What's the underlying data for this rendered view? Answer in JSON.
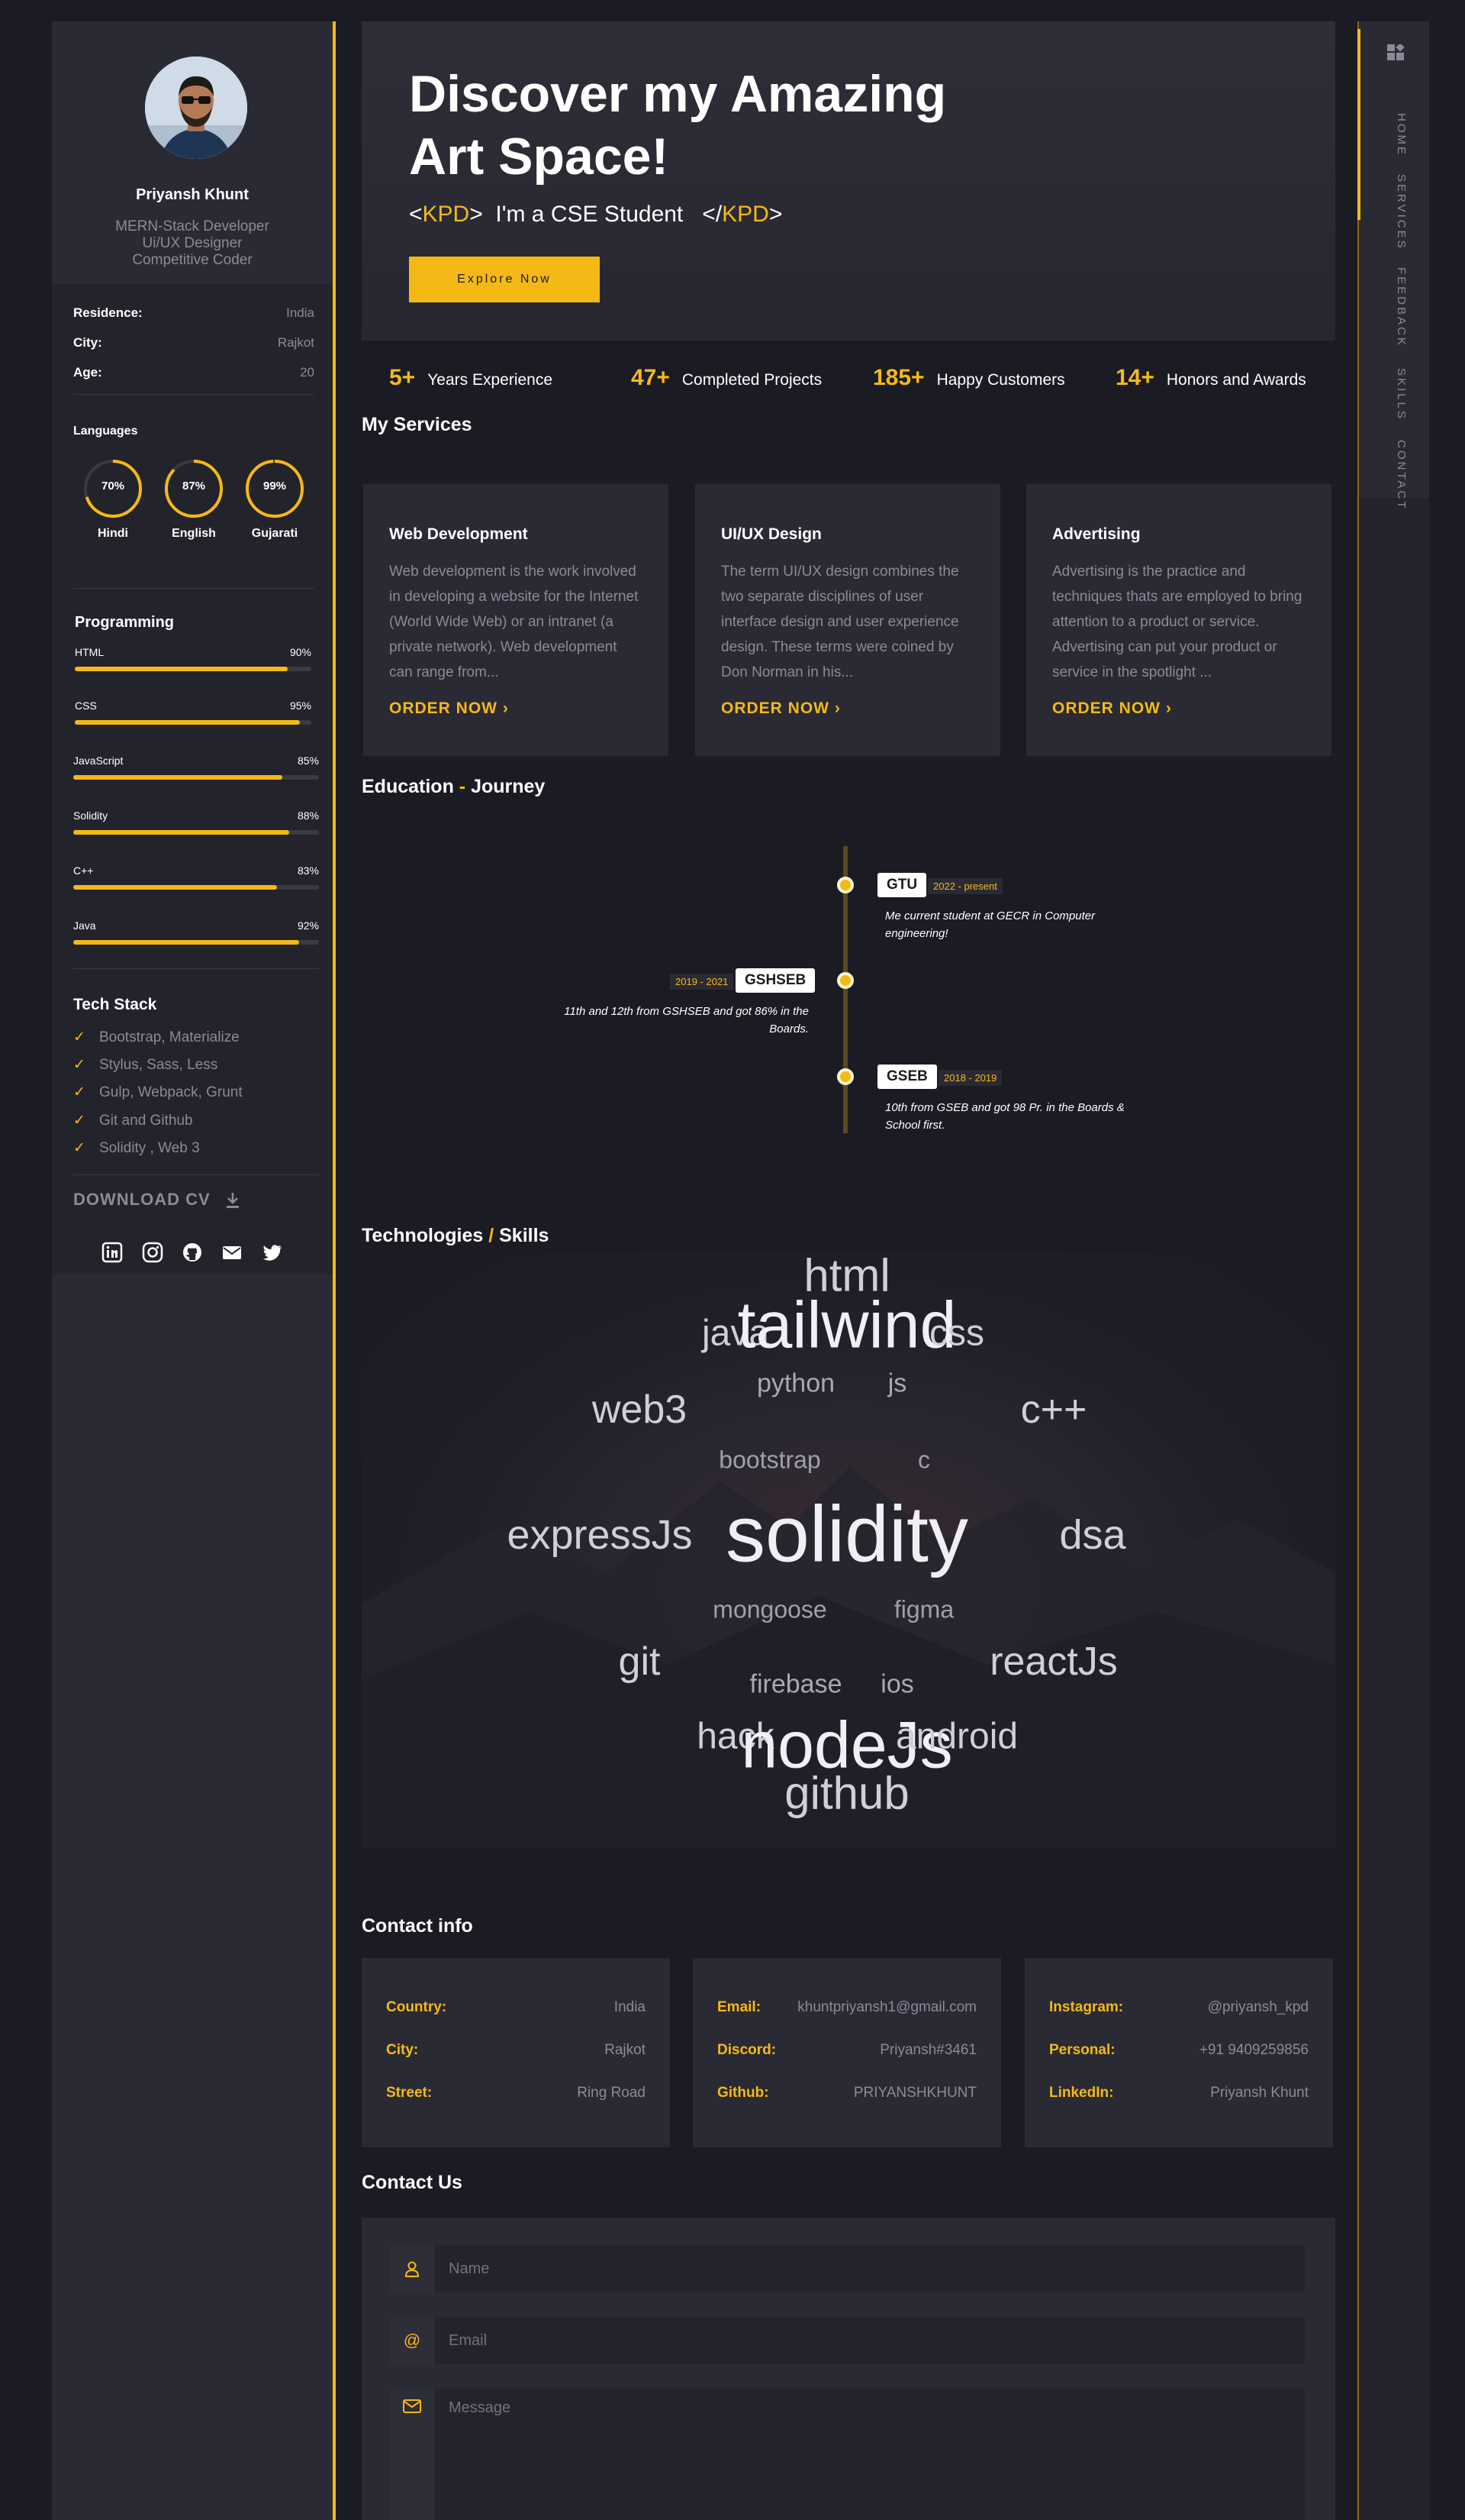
{
  "profile": {
    "name": "Priyansh Khunt",
    "roles": [
      "MERN-Stack Developer",
      "Ui/UX Designer",
      "Competitive Coder"
    ]
  },
  "info": [
    {
      "label": "Residence:",
      "value": "India"
    },
    {
      "label": "City:",
      "value": "Rajkot"
    },
    {
      "label": "Age:",
      "value": "20"
    }
  ],
  "languages": {
    "title": "Languages",
    "items": [
      {
        "name": "Hindi",
        "percent_label": "70%",
        "percent": 70
      },
      {
        "name": "English",
        "percent_label": "87%",
        "percent": 87
      },
      {
        "name": "Gujarati",
        "percent_label": "99%",
        "percent": 99
      }
    ]
  },
  "programming": {
    "title": "Programming",
    "items": [
      {
        "name": "HTML",
        "percent_label": "90%",
        "percent": 90
      },
      {
        "name": "CSS",
        "percent_label": "95%",
        "percent": 95
      },
      {
        "name": "JavaScript",
        "percent_label": "85%",
        "percent": 85
      },
      {
        "name": "Solidity",
        "percent_label": "88%",
        "percent": 88
      },
      {
        "name": "C++",
        "percent_label": "83%",
        "percent": 83
      },
      {
        "name": "Java",
        "percent_label": "92%",
        "percent": 92
      }
    ]
  },
  "tech_stack": {
    "title": "Tech Stack",
    "items": [
      "Bootstrap, Materialize",
      "Stylus, Sass, Less",
      "Gulp, Webpack, Grunt",
      "Git and Github",
      "Solidity , Web 3"
    ]
  },
  "download_cv": "DOWNLOAD CV",
  "socials": [
    "linkedin-icon",
    "instagram-icon",
    "github-icon",
    "email-icon",
    "twitter-icon"
  ],
  "hero": {
    "title_line1": "Discover my Amazing",
    "title_line2": "Art Space!",
    "tag_open": "<",
    "tag_name": "KPD",
    "tag_mid": ">",
    "tagline": "I'm a CSE Student",
    "tag_close_open": "</",
    "tag_close_end": ">",
    "button": "Explore Now"
  },
  "stats": [
    {
      "value": "5+",
      "label": "Years Experience"
    },
    {
      "value": "47+",
      "label": "Completed Projects"
    },
    {
      "value": "185+",
      "label": "Happy Customers"
    },
    {
      "value": "14+",
      "label": "Honors and Awards"
    }
  ],
  "services": {
    "title": "My Services",
    "items": [
      {
        "title": "Web Development",
        "text": "Web development is the work involved in developing a website for the Internet (World Wide Web) or an intranet (a private network). Web development can range from...",
        "cta": "ORDER NOW"
      },
      {
        "title": "UI/UX Design",
        "text": "The term UI/UX design combines the two separate disciplines of user interface design and user experience design. These terms were coined by Don Norman in his...",
        "cta": "ORDER NOW"
      },
      {
        "title": "Advertising",
        "text": "Advertising is the practice and techniques thats are employed to bring attention to a product or service. Advertising can put your product or service in the spotlight ...",
        "cta": "ORDER NOW"
      }
    ]
  },
  "education": {
    "title_a": "Education",
    "title_sep": " - ",
    "title_b": "Journey",
    "items": [
      {
        "name": "GTU",
        "years": "2022 - present",
        "text": "Me current student at GECR in Computer engineering!"
      },
      {
        "name": "GSHSEB",
        "years": "2019 - 2021",
        "text": "11th and 12th from GSHSEB and got 86% in the Boards."
      },
      {
        "name": "GSEB",
        "years": "2018 - 2019",
        "text": "10th from GSEB and got 98 Pr. in the Boards & School first."
      }
    ]
  },
  "skills": {
    "title_a": "Technologies",
    "title_sep": " / ",
    "title_b": "Skills",
    "words": [
      "html",
      "java",
      "tailwind",
      "css",
      "python",
      "js",
      "web3",
      "c++",
      "bootstrap",
      "c",
      "expressJs",
      "solidity",
      "dsa",
      "mongoose",
      "figma",
      "git",
      "reactJs",
      "firebase",
      "ios",
      "hack",
      "nodeJs",
      "android",
      "github"
    ]
  },
  "contact_info": {
    "title": "Contact info",
    "cards": [
      [
        {
          "k": "Country:",
          "v": "India"
        },
        {
          "k": "City:",
          "v": "Rajkot"
        },
        {
          "k": "Street:",
          "v": "Ring Road"
        }
      ],
      [
        {
          "k": "Email:",
          "v": "khuntpriyansh1@gmail.com"
        },
        {
          "k": "Discord:",
          "v": "Priyansh#3461"
        },
        {
          "k": "Github:",
          "v": "PRIYANSHKHUNT"
        }
      ],
      [
        {
          "k": "Instagram:",
          "v": "@priyansh_kpd"
        },
        {
          "k": "Personal:",
          "v": "+91 9409259856"
        },
        {
          "k": "LinkedIn:",
          "v": "Priyansh Khunt"
        }
      ]
    ]
  },
  "contact_us": {
    "title": "Contact Us",
    "name_placeholder": "Name",
    "email_placeholder": "Email",
    "message_placeholder": "Message"
  },
  "nav": [
    "HOME",
    "SERVICES",
    "FEEDBACK",
    "SKILLS",
    "CONTACT"
  ],
  "colors": {
    "accent": "#f5b916",
    "background": "#1b1b23",
    "card": "#2a2a35",
    "muted_text": "#8b8b97"
  }
}
